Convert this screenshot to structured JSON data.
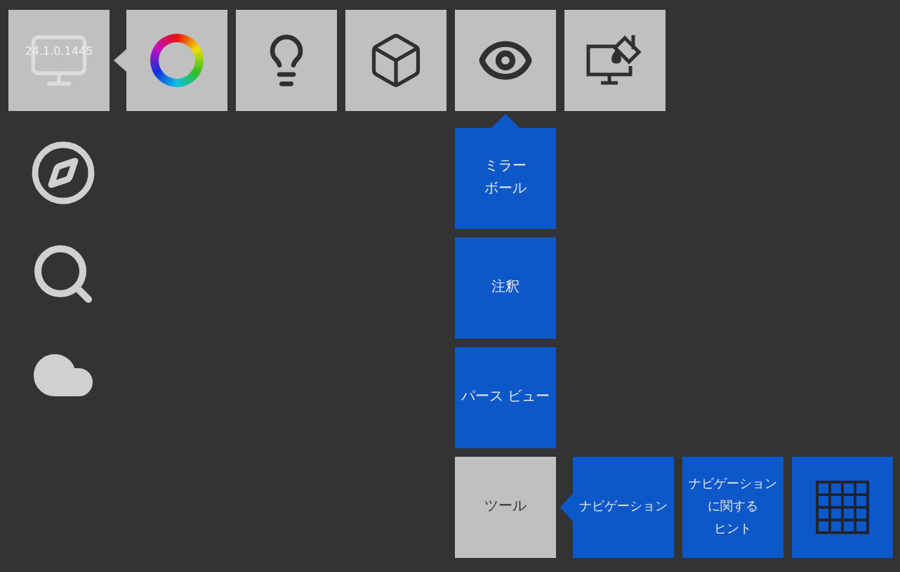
{
  "top_tiles": [
    {
      "kind": "monitor",
      "label": "24.1.0.1445",
      "selected": false
    },
    {
      "kind": "color-wheel",
      "selected": false
    },
    {
      "kind": "bulb",
      "selected": false
    },
    {
      "kind": "cube",
      "selected": false
    },
    {
      "kind": "eye",
      "selected": true
    },
    {
      "kind": "monitor-paint",
      "selected": false
    }
  ],
  "side_icons": [
    {
      "kind": "compass"
    },
    {
      "kind": "search"
    },
    {
      "kind": "cloud"
    }
  ],
  "submenu": [
    {
      "lines": [
        "ミラー",
        "ボール"
      ],
      "selected": false
    },
    {
      "lines": [
        "注釈"
      ],
      "selected": false
    },
    {
      "lines": [
        "パース ビュー"
      ],
      "selected": false
    },
    {
      "lines": [
        "ツール"
      ],
      "selected": true
    }
  ],
  "tools": [
    {
      "kind": "text",
      "lines": [
        "ナビゲーション"
      ]
    },
    {
      "kind": "text",
      "lines": [
        "ナビゲーション",
        "に関する",
        "ヒント"
      ]
    },
    {
      "kind": "grid"
    }
  ]
}
